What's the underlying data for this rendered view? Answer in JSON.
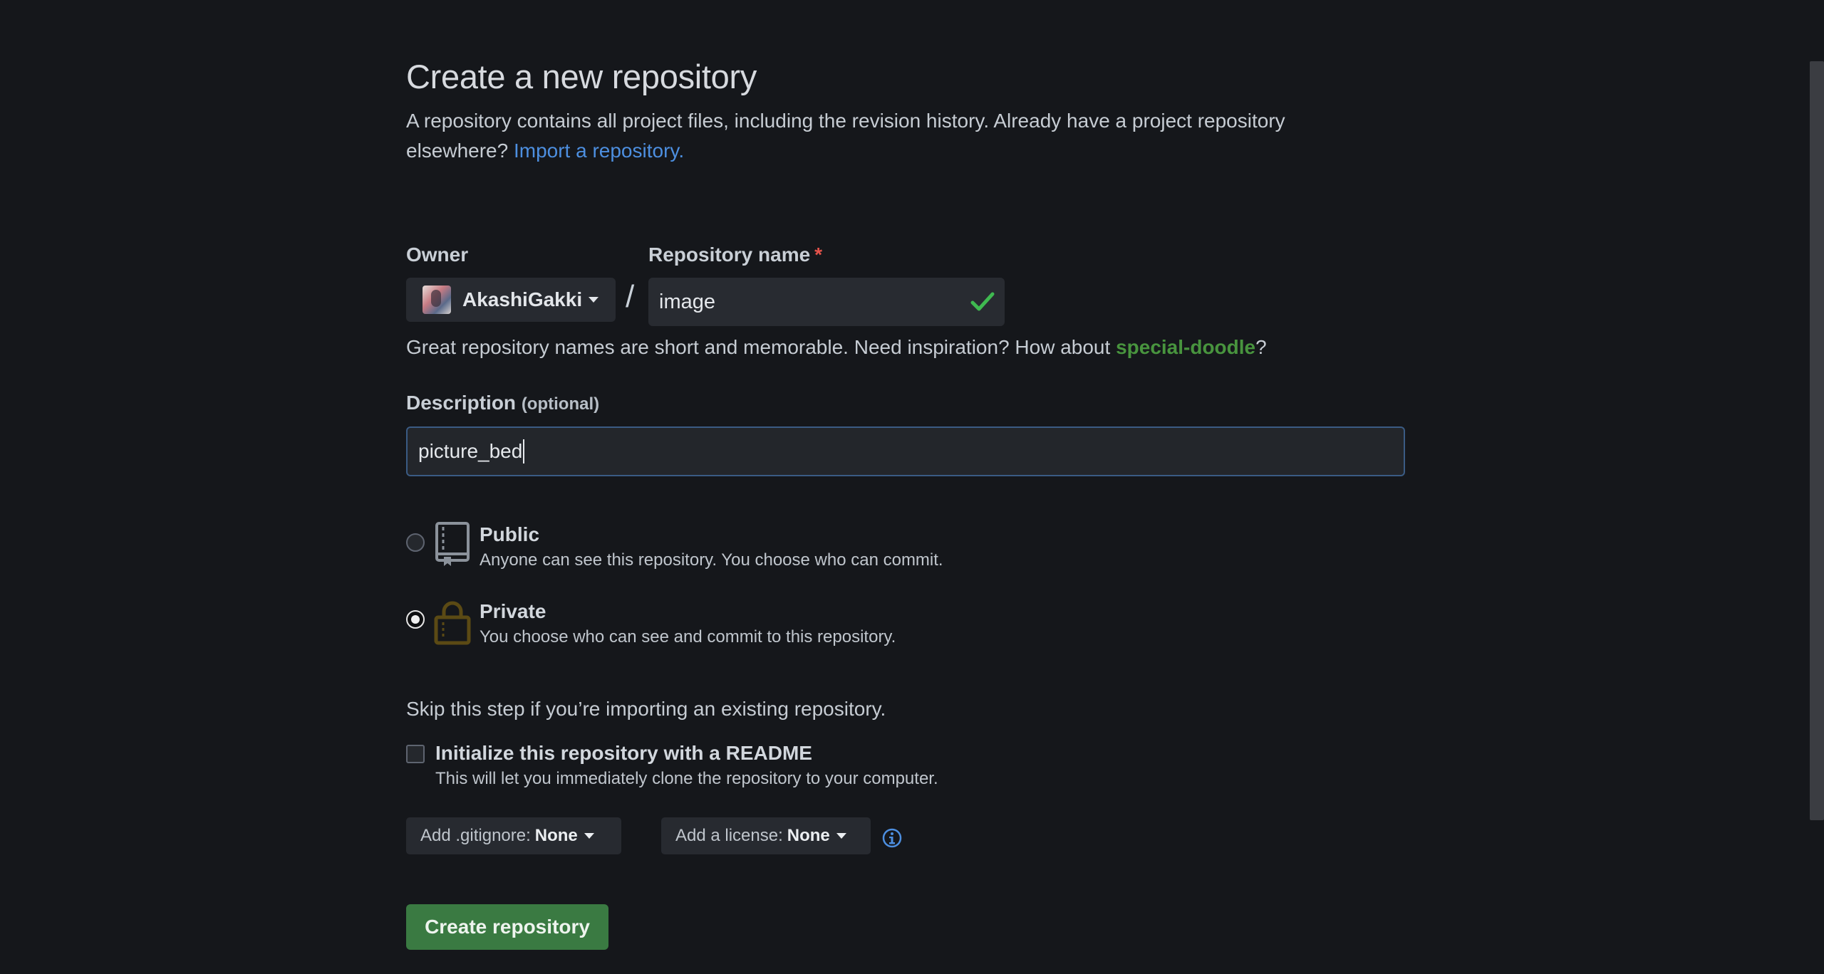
{
  "page": {
    "title": "Create a new repository",
    "intro_text": "A repository contains all project files, including the revision history. Already have a project repository elsewhere?",
    "import_link": "Import a repository."
  },
  "owner": {
    "label": "Owner",
    "name": "AkashiGakki",
    "avatar_icon": "user-avatar"
  },
  "repo_name": {
    "label": "Repository name",
    "required_mark": "*",
    "value": "image",
    "valid_icon": "check-icon",
    "valid_color": "#3fb950"
  },
  "separator": "/",
  "hint": {
    "text": "Great repository names are short and memorable. Need inspiration? How about",
    "suggestion": "special-doodle",
    "suffix": "?"
  },
  "description": {
    "label": "Description",
    "optional": "(optional)",
    "value": "picture_bed"
  },
  "visibility": {
    "selected": "private",
    "public": {
      "title": "Public",
      "desc": "Anyone can see this repository. You choose who can commit.",
      "icon": "repo-icon"
    },
    "private": {
      "title": "Private",
      "desc": "You choose who can see and commit to this repository.",
      "icon": "lock-icon"
    }
  },
  "init": {
    "skip_text": "Skip this step if you’re importing an existing repository.",
    "readme_title": "Initialize this repository with a README",
    "readme_desc": "This will let you immediately clone the repository to your computer.",
    "readme_checked": false
  },
  "gitignore": {
    "label": "Add .gitignore:",
    "value": "None"
  },
  "license": {
    "label": "Add a license:",
    "value": "None",
    "info_icon": "info-icon"
  },
  "submit": {
    "label": "Create repository"
  },
  "colors": {
    "background": "#15171b",
    "link": "#4d8fe0",
    "suggestion": "#48943e",
    "primary_button": "#3a7a42",
    "required": "#e5534b"
  }
}
